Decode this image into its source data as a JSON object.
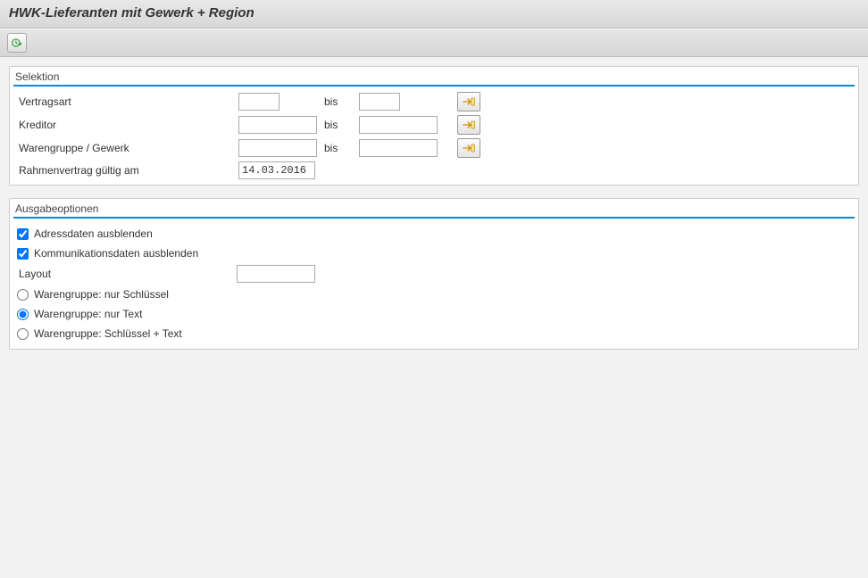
{
  "title": "HWK-Lieferanten mit Gewerk +  Region",
  "sections": {
    "selektion": {
      "header": "Selektion",
      "rows": {
        "vertragsart": {
          "label": "Vertragsart",
          "from": "",
          "bis_label": "bis",
          "to": ""
        },
        "kreditor": {
          "label": "Kreditor",
          "from": "",
          "bis_label": "bis",
          "to": ""
        },
        "warengruppe": {
          "label": "Warengruppe / Gewerk",
          "from": "",
          "bis_label": "bis",
          "to": ""
        },
        "rahmenvertrag": {
          "label": "Rahmenvertrag gültig am",
          "value": "14.03.2016"
        }
      }
    },
    "ausgabe": {
      "header": "Ausgabeoptionen",
      "chk_adress": {
        "label": "Adressdaten ausblenden",
        "checked": true
      },
      "chk_komm": {
        "label": "Kommunikationsdaten ausblenden",
        "checked": true
      },
      "layout": {
        "label": "Layout",
        "value": ""
      },
      "radio": {
        "selected": "text",
        "schluessel": "Warengruppe: nur Schlüssel",
        "text": "Warengruppe: nur Text",
        "both": "Warengruppe: Schlüssel + Text"
      }
    }
  }
}
